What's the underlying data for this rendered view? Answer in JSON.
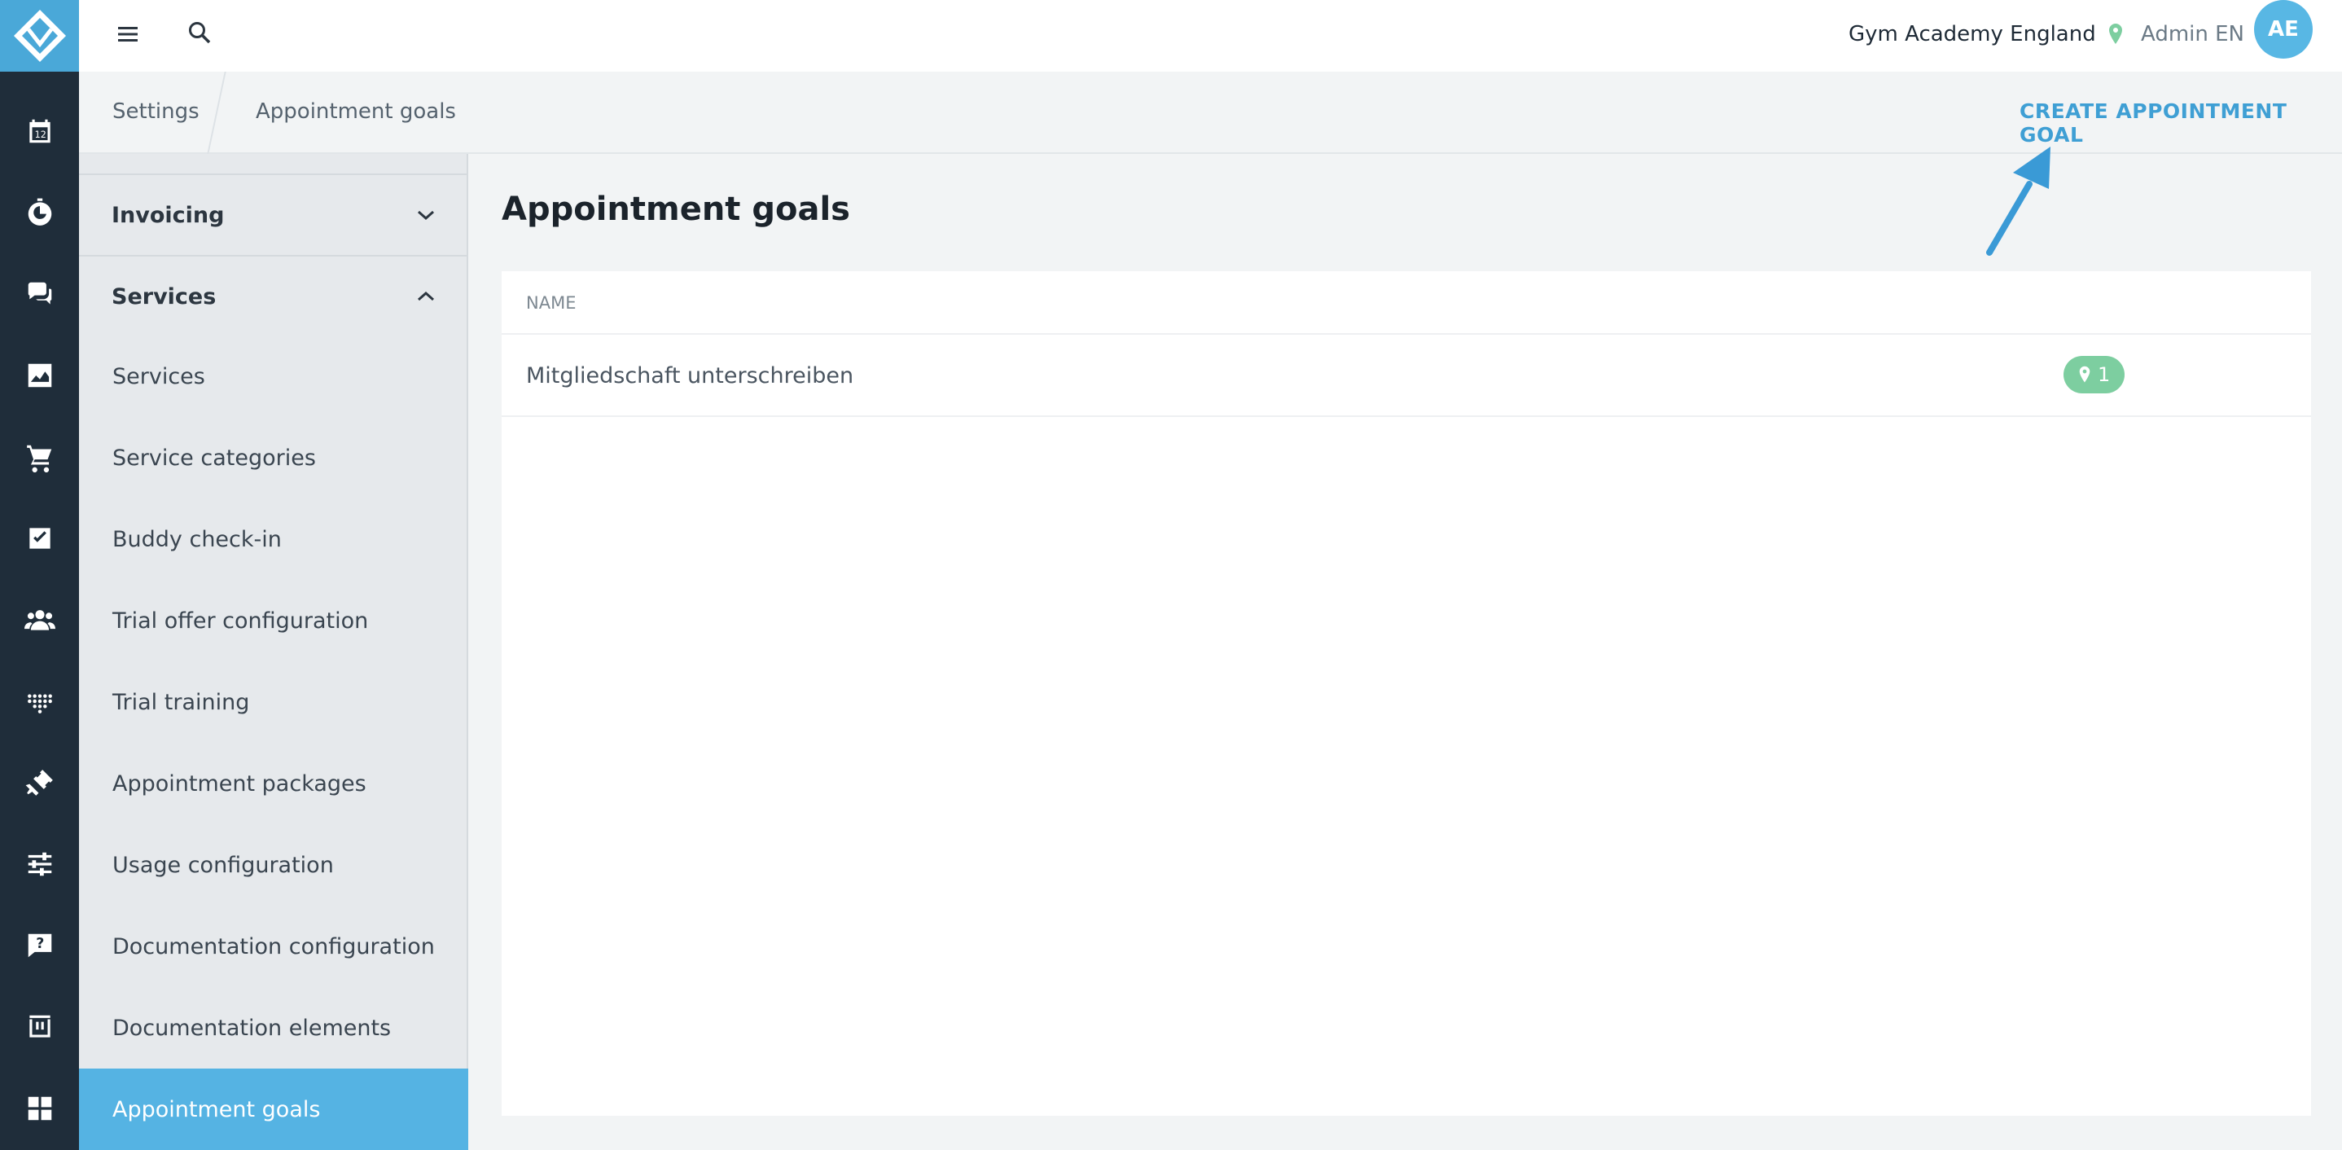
{
  "topbar": {
    "studio_name": "Gym Academy England",
    "user_name": "Admin EN",
    "avatar_initials": "AE"
  },
  "breadcrumb": {
    "parent": "Settings",
    "current": "Appointment goals"
  },
  "actions": {
    "create_label": "CREATE APPOINTMENT GOAL"
  },
  "sidebar": {
    "groups": [
      {
        "label": "Invoicing",
        "expanded": false
      },
      {
        "label": "Services",
        "expanded": true
      }
    ],
    "items": [
      {
        "label": "Services"
      },
      {
        "label": "Service categories"
      },
      {
        "label": "Buddy check-in"
      },
      {
        "label": "Trial offer configuration"
      },
      {
        "label": "Trial training"
      },
      {
        "label": "Appointment packages"
      },
      {
        "label": "Usage configuration"
      },
      {
        "label": "Documentation configuration"
      },
      {
        "label": "Documentation elements"
      },
      {
        "label": "Appointment goals",
        "active": true
      }
    ]
  },
  "main": {
    "title": "Appointment goals",
    "table": {
      "columns": [
        "NAME"
      ],
      "rows": [
        {
          "name": "Mitgliedschaft unterschreiben",
          "location_count": "1"
        }
      ]
    }
  },
  "rail_icons": [
    "calendar-icon",
    "stopwatch-icon",
    "chat-icon",
    "chart-icon",
    "cart-icon",
    "checkbox-icon",
    "users-icon",
    "dots-grid-icon",
    "dumbbell-icon",
    "sliders-icon",
    "help-chat-icon",
    "shop-icon",
    "dashboard-icon"
  ],
  "colors": {
    "accent": "#4aa8d8",
    "rail": "#1f2d3a",
    "active_item": "#55b3e3",
    "badge": "#7dcea0",
    "location_pin": "#7dcea0"
  }
}
